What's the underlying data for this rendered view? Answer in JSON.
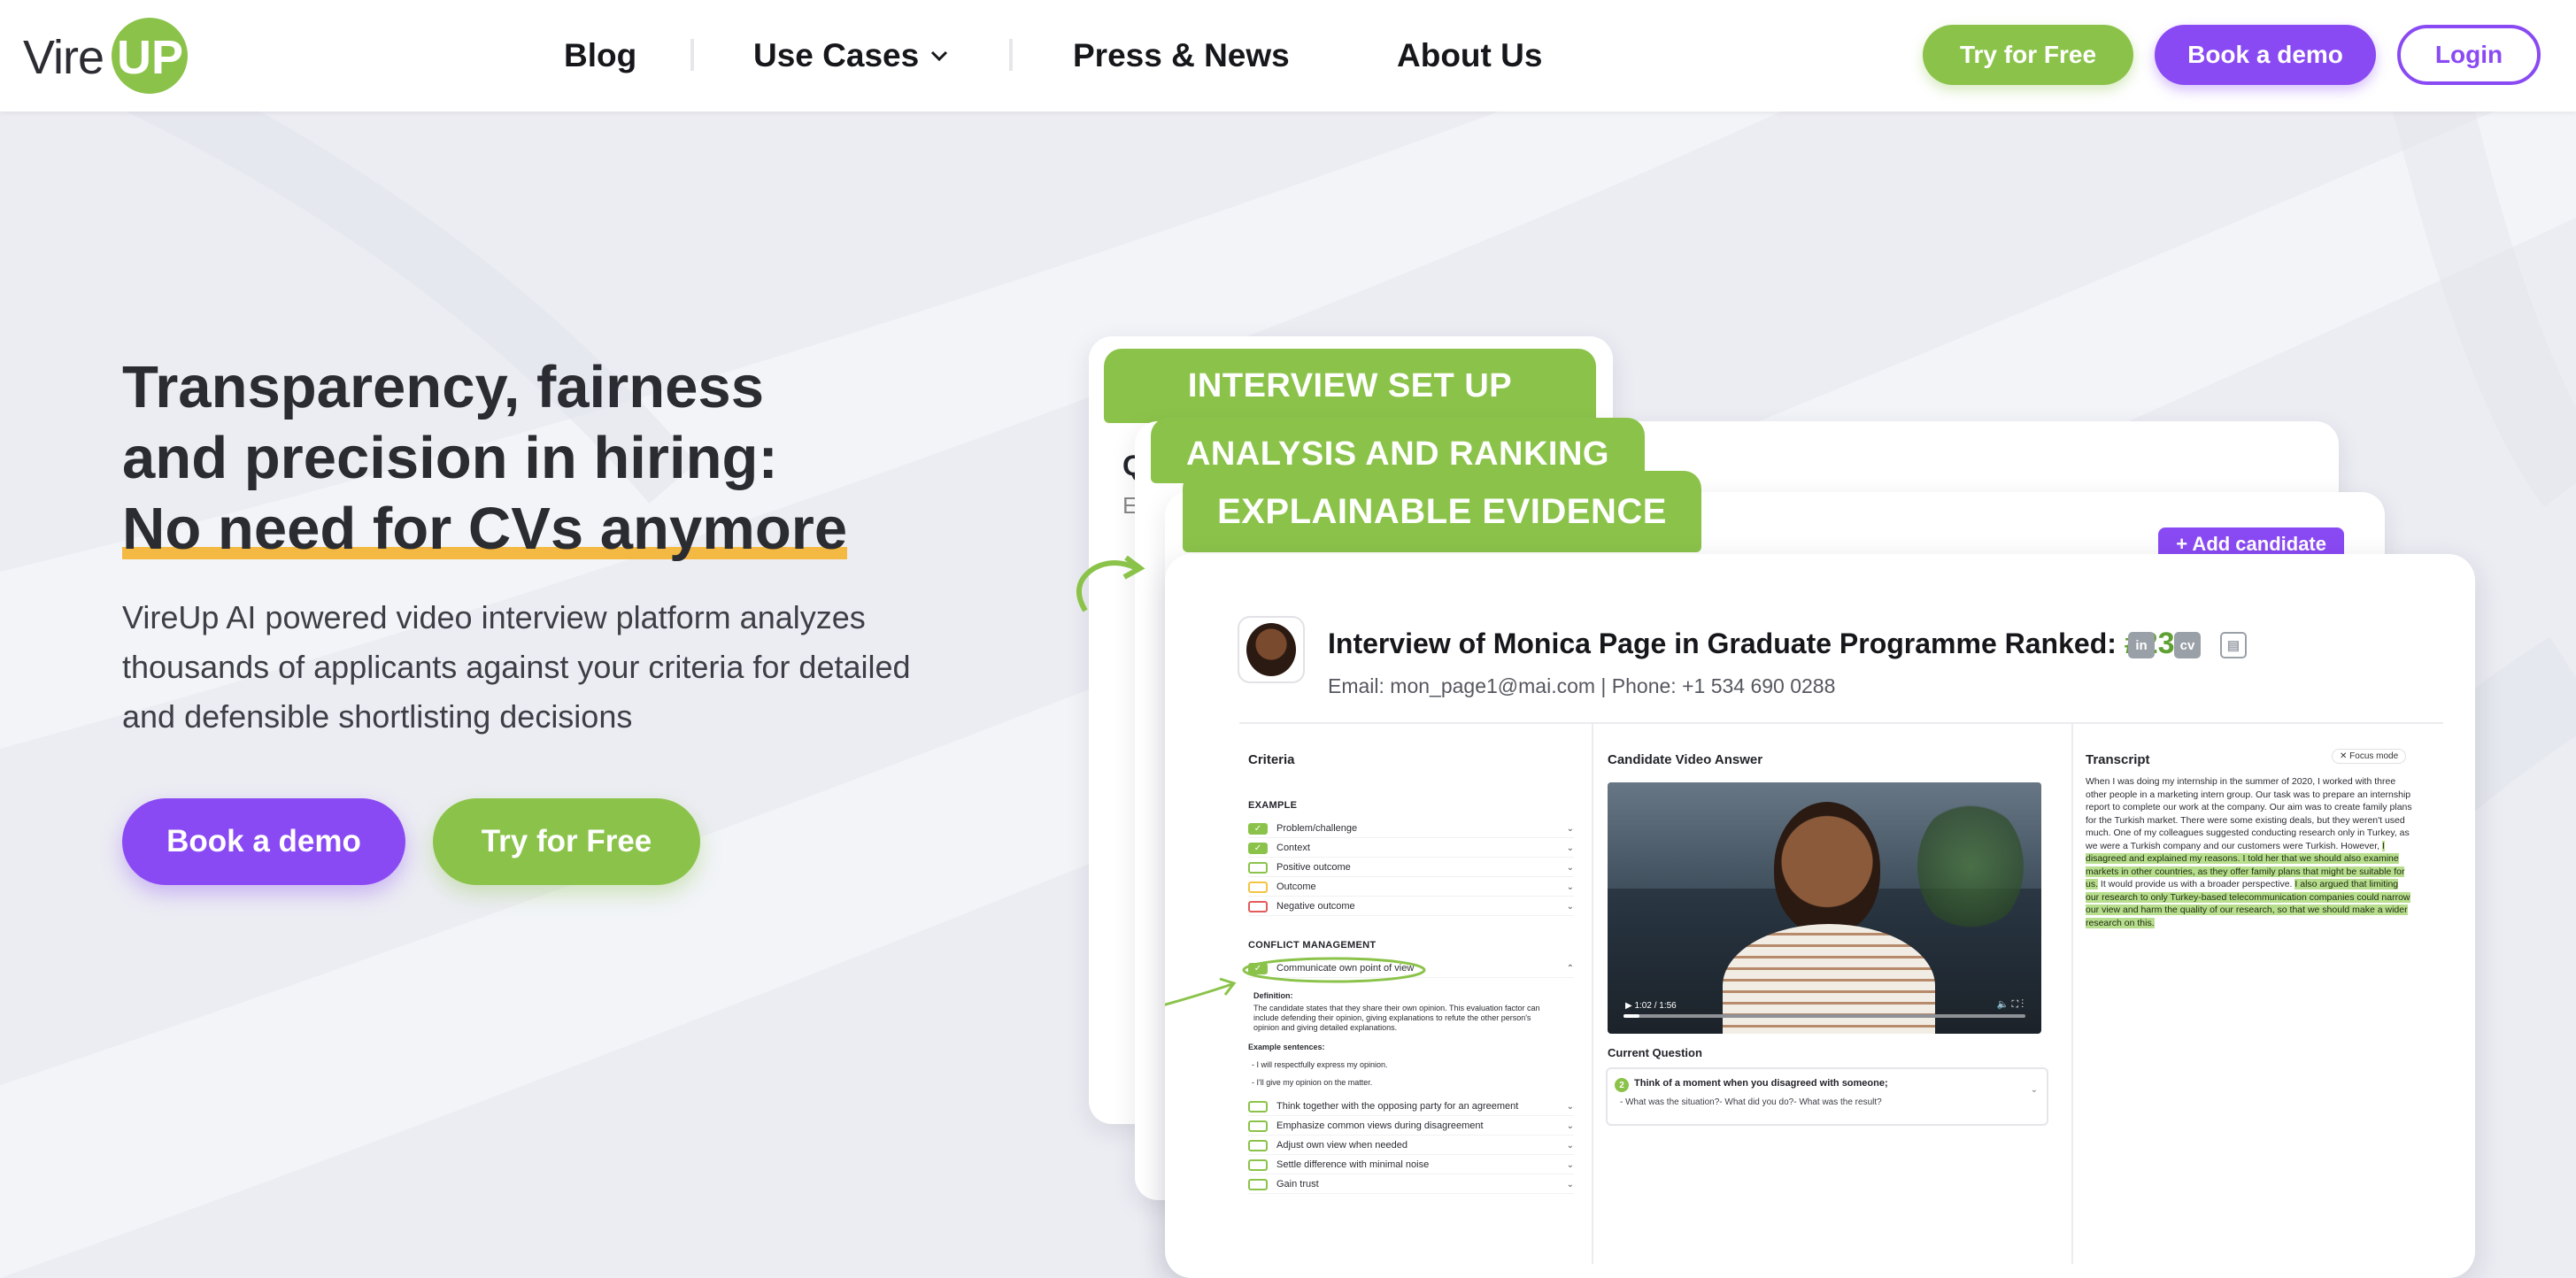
{
  "brand": {
    "logo_word": "Vire",
    "logo_mark": "UP",
    "accent_green": "#8bc34a",
    "accent_purple": "#8a4af3"
  },
  "nav": {
    "items": [
      {
        "label": "Blog"
      },
      {
        "label": "Use Cases",
        "icon": "chevron-down-icon"
      },
      {
        "label": "Press & News"
      },
      {
        "label": "About Us"
      }
    ],
    "try_free": "Try for Free",
    "book_demo": "Book a demo",
    "login": "Login"
  },
  "hero": {
    "title_line1": "Transparency, fairness",
    "title_line2": "and precision in hiring:",
    "title_line3": "No need for CVs anymore",
    "description": "VireUp AI powered video interview platform analyzes thousands of applicants against your criteria for detailed and defensible shortlisting decisions",
    "cta_book": "Book a demo",
    "cta_try": "Try for Free"
  },
  "cards": {
    "tab1": "INTERVIEW SET UP",
    "tab2": "ANALYSIS AND RANKING",
    "tab3": "EXPLAINABLE EVIDENCE",
    "card1_partial_heading": "Q",
    "card1_partial_sub": "E",
    "add_candidate": "+ Add candidate"
  },
  "interview": {
    "title": "Interview of Monica Page in Graduate Programme Ranked:",
    "rank": "#23",
    "icons": [
      "linkedin-icon",
      "cv-icon",
      "document-icon"
    ],
    "contact": "Email: mon_page1@mai.com  | Phone: +1 534 690 0288",
    "criteria_title": "Criteria",
    "video_title": "Candidate Video Answer",
    "transcript_title": "Transcript",
    "focus_mode": "✕ Focus mode",
    "section_example": "EXAMPLE",
    "example_items": [
      {
        "label": "Problem/challenge",
        "state": "on"
      },
      {
        "label": "Context",
        "state": "on"
      },
      {
        "label": "Positive outcome",
        "state": "off"
      },
      {
        "label": "Outcome",
        "state": "amber"
      },
      {
        "label": "Negative outcome",
        "state": "red"
      }
    ],
    "section_conflict": "CONFLICT MANAGEMENT",
    "conflict_open": "Communicate own point of view",
    "definition_label": "Definition:",
    "definition_text": "The candidate states that they share their own opinion. This evaluation factor can include defending their opinion, giving explanations to refute the other person's opinion and giving detailed explanations.",
    "example_sentences_label": "Example sentences:",
    "example_sentence1": "- I will respectfully express my opinion.",
    "example_sentence2": "- I'll give my opinion on the matter.",
    "conflict_items": [
      "Think together with the opposing party for an agreement",
      "Emphasize common views during disagreement",
      "Adjust own view when needed",
      "Settle difference with minimal noise",
      "Gain trust"
    ],
    "video_time": "1:02 / 1:56",
    "current_question_label": "Current Question",
    "question_number": "2",
    "question_text": "Think of a moment when you disagreed with someone;",
    "question_sub": "- What was the situation?- What did you do?- What was the result?",
    "transcript_plain": "When I was doing my internship in the summer of 2020, I worked with three other people in a marketing intern group. Our task was to prepare an internship report to complete our work at the company. Our aim was to create family plans for the Turkish market. There were some existing deals, but they weren't used much. One of my colleagues suggested conducting research only in Turkey, as we were a Turkish company and our customers were Turkish. However, ",
    "transcript_hl1": "I disagreed and explained my reasons. I told her that we should also examine markets in other countries, as they offer family plans that might be suitable for us.",
    "transcript_mid": " It would provide us with a broader perspective. ",
    "transcript_hl2": "I also argued that limiting our research to only Turkey-based telecommunication companies could narrow our view and harm the quality of our research, so that we should make a wider research on this."
  }
}
